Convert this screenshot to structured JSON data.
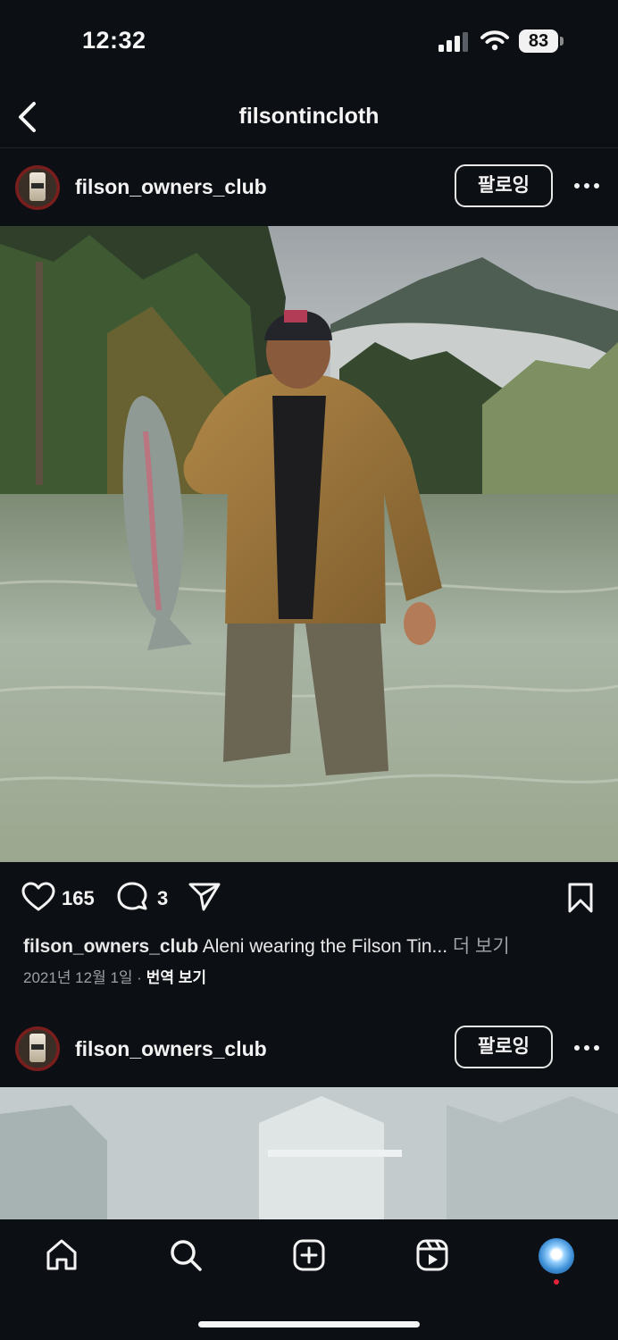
{
  "status_bar": {
    "time": "12:32",
    "battery": "83"
  },
  "nav": {
    "title": "filsontincloth"
  },
  "post1": {
    "username": "filson_owners_club",
    "follow_label": "팔로잉",
    "likes": "165",
    "comments": "3",
    "caption_user": "filson_owners_club",
    "caption_text": "Aleni wearing the Filson Tin...",
    "caption_more": "더 보기",
    "date": "2021년 12월 1일",
    "separator": "·",
    "translate": "번역 보기"
  },
  "post2": {
    "username": "filson_owners_club",
    "follow_label": "팔로잉"
  },
  "tabbar": {
    "items": [
      "home-icon",
      "search-icon",
      "create-icon",
      "reels-icon",
      "profile-icon"
    ]
  },
  "colors": {
    "background": "#0c0f14",
    "text": "#f5f5f5",
    "muted": "#9aa0a6",
    "notification_dot": "#e0243a"
  }
}
